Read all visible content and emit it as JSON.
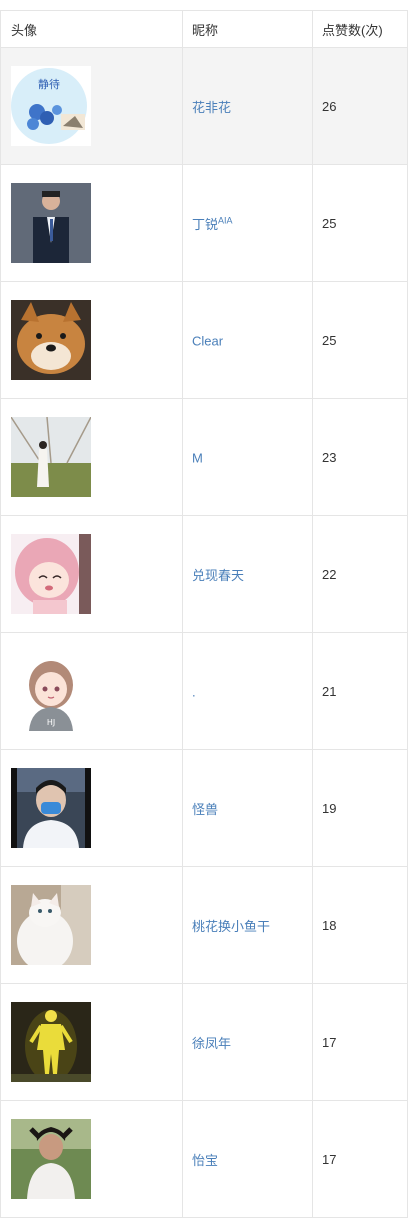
{
  "table": {
    "columns": [
      "头像",
      "昵称",
      "点赞数(次)"
    ],
    "rows": [
      {
        "name": "花非花",
        "suffix": "",
        "likes": "26",
        "avatar": "flower-logo-avatar",
        "badge_text": "静待"
      },
      {
        "name": "丁锐",
        "suffix": "AIA",
        "likes": "25",
        "avatar": "man-in-suit-avatar"
      },
      {
        "name": "Clear",
        "suffix": "",
        "likes": "25",
        "avatar": "shiba-dog-avatar"
      },
      {
        "name": "M",
        "suffix": "",
        "likes": "23",
        "avatar": "girl-in-field-avatar"
      },
      {
        "name": "兑现春天",
        "suffix": "",
        "likes": "22",
        "avatar": "anime-pink-hair-avatar"
      },
      {
        "name": ".",
        "suffix": "",
        "likes": "21",
        "avatar": "cartoon-girl-avatar"
      },
      {
        "name": "怪兽",
        "suffix": "",
        "likes": "19",
        "avatar": "masked-person-avatar"
      },
      {
        "name": "桃花换小鱼干",
        "suffix": "",
        "likes": "18",
        "avatar": "white-cat-avatar"
      },
      {
        "name": "徐凤年",
        "suffix": "",
        "likes": "17",
        "avatar": "glowing-figure-avatar"
      },
      {
        "name": "怡宝",
        "suffix": "",
        "likes": "17",
        "avatar": "girl-outdoors-avatar"
      }
    ]
  },
  "colors": {
    "link": "#4a7fb9",
    "text": "#333333",
    "border": "#e5e5e5",
    "shaded_row": "#f4f4f4"
  }
}
